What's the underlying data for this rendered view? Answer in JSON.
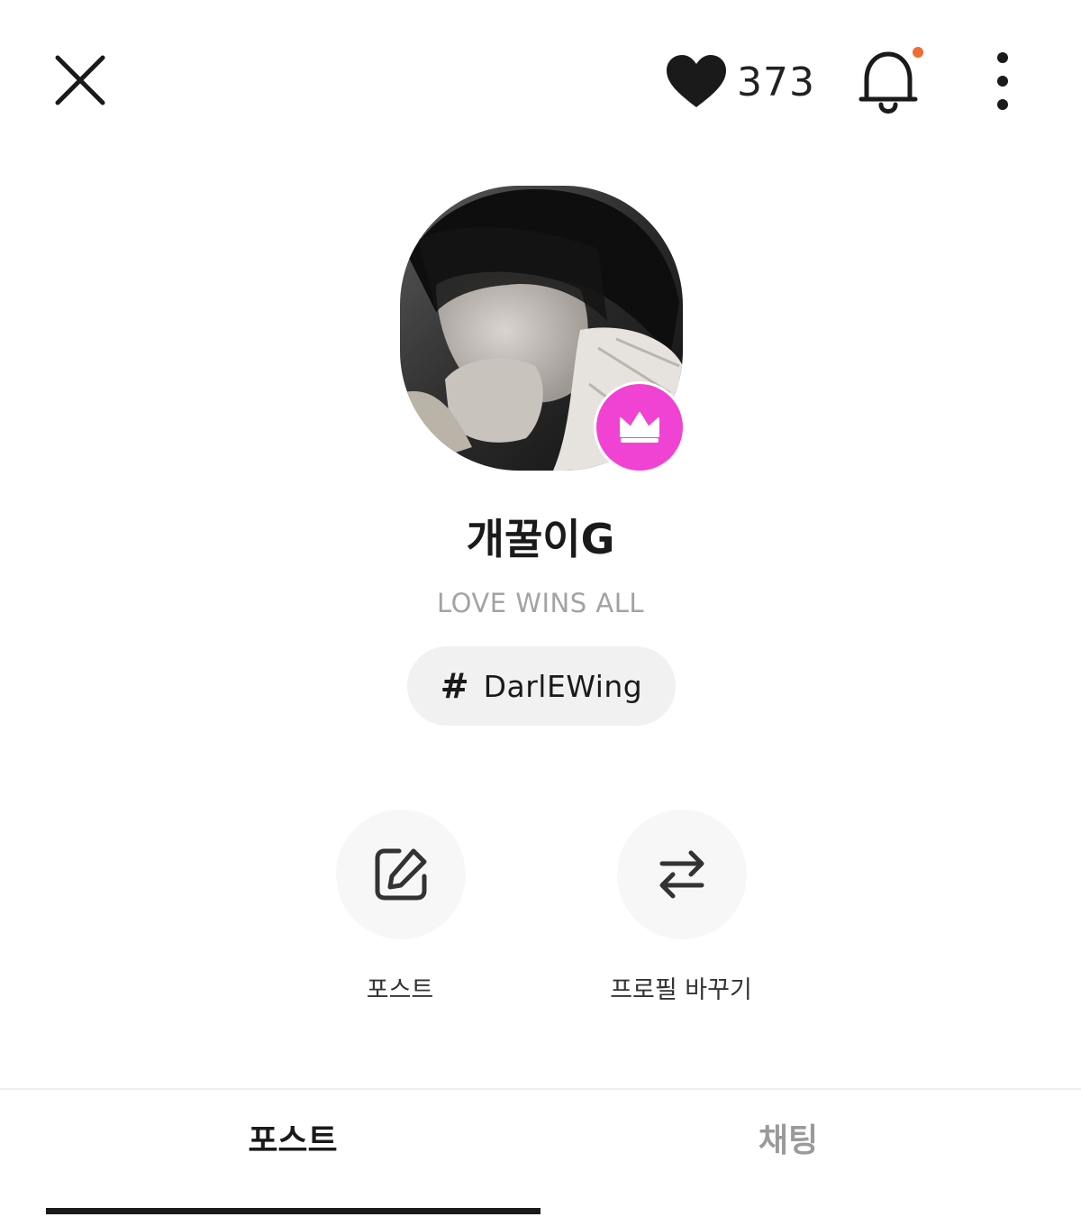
{
  "header": {
    "close_icon": "close-icon",
    "like_icon": "heart-icon",
    "like_count": "373",
    "bell_icon": "bell-icon",
    "notification_dot_color": "#f26b35",
    "more_icon": "more-vertical-icon"
  },
  "profile": {
    "avatar": "profile-photo",
    "badge_icon": "crown-icon",
    "badge_color": "#f043d4",
    "name": "개꿀이G",
    "bio": "LOVE WINS ALL",
    "hashtag_symbol": "#",
    "hashtag": "DarlEWing"
  },
  "actions": [
    {
      "icon": "edit-icon",
      "label": "포스트"
    },
    {
      "icon": "swap-icon",
      "label": "프로필 바꾸기"
    }
  ],
  "tabs": [
    {
      "label": "포스트",
      "active": true
    },
    {
      "label": "채팅",
      "active": false
    }
  ]
}
